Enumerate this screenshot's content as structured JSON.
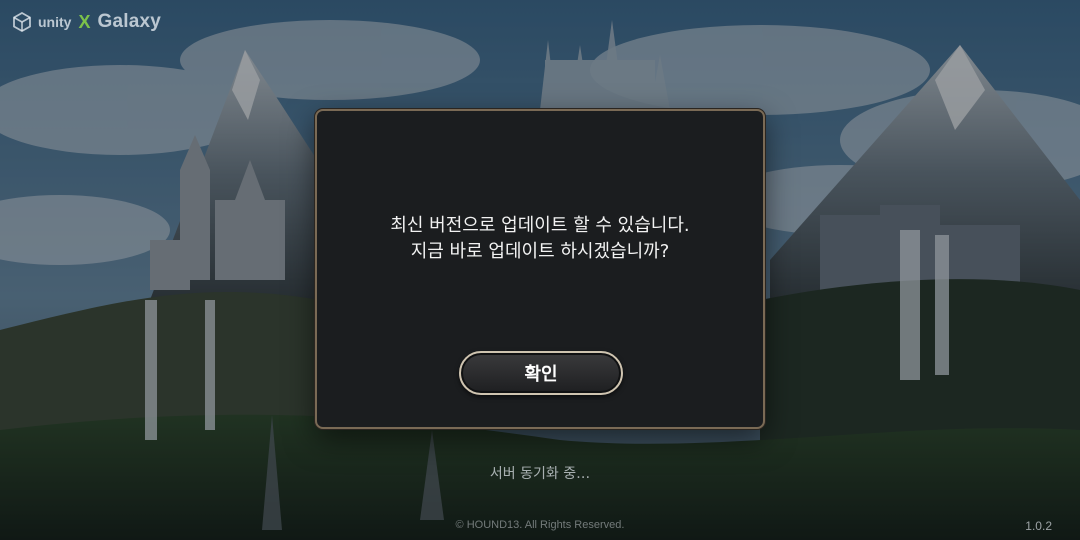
{
  "brand": {
    "engine_logo_text": "unity",
    "separator": "X",
    "platform_logo_text": "Galaxy"
  },
  "dialog": {
    "message_line1": "최신 버전으로 업데이트 할 수 있습니다.",
    "message_line2": "지금 바로 업데이트 하시겠습니까?",
    "confirm_label": "확인"
  },
  "status": {
    "sync_text": "서버 동기화 중…"
  },
  "footer": {
    "copyright": "© HOUND13. All Rights Reserved.",
    "version": "1.0.2"
  },
  "colors": {
    "dialog_background": "#1b1d1f",
    "dialog_border": "#7a6a55",
    "button_border": "#cfc4b0",
    "text_primary": "#f2f2f2",
    "galaxy_x_accent": "#7cc24a"
  },
  "icons": [
    "unity-logo-icon",
    "galaxy-x-icon"
  ]
}
